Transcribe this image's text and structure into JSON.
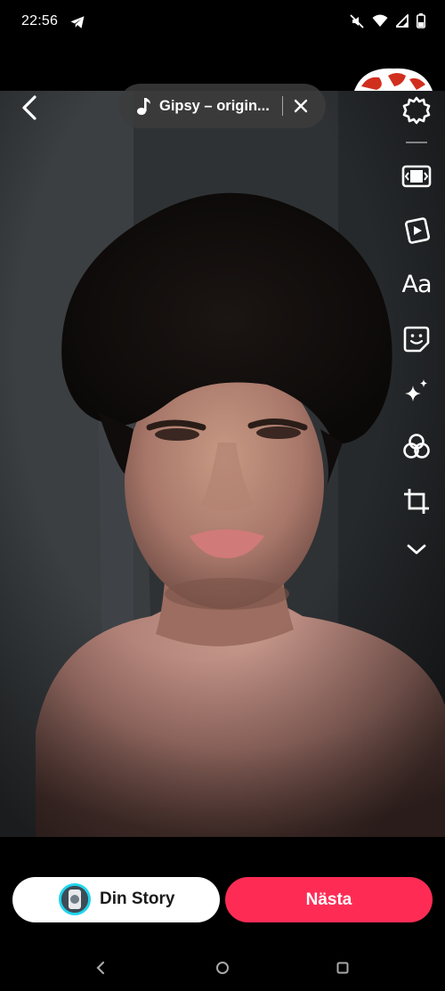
{
  "status_bar": {
    "time": "22:56",
    "icons": [
      "telegram-icon",
      "mute-icon",
      "wifi-icon",
      "signal-icon",
      "battery-icon"
    ]
  },
  "top": {
    "back_icon": "chevron-left-icon",
    "sound": {
      "icon": "music-note-icon",
      "title": "Gipsy – origin...",
      "close_icon": "close-icon"
    }
  },
  "tools": [
    {
      "name": "settings",
      "icon": "gear-icon"
    },
    {
      "name": "aspect-ratio",
      "icon": "aspect-ratio-icon"
    },
    {
      "name": "templates",
      "icon": "templates-icon"
    },
    {
      "name": "text",
      "icon": "text-icon",
      "label": "Aa"
    },
    {
      "name": "stickers",
      "icon": "sticker-icon"
    },
    {
      "name": "effects",
      "icon": "sparkle-icon"
    },
    {
      "name": "filters",
      "icon": "filters-icon"
    },
    {
      "name": "crop",
      "icon": "crop-icon"
    },
    {
      "name": "more",
      "icon": "chevron-down-icon"
    }
  ],
  "bottom": {
    "story_label": "Din Story",
    "next_label": "Nästa"
  },
  "colors": {
    "accent": "#fe2c55",
    "story_ring": "#20d5ec"
  },
  "nav": [
    "back-icon",
    "home-icon",
    "recents-icon"
  ]
}
